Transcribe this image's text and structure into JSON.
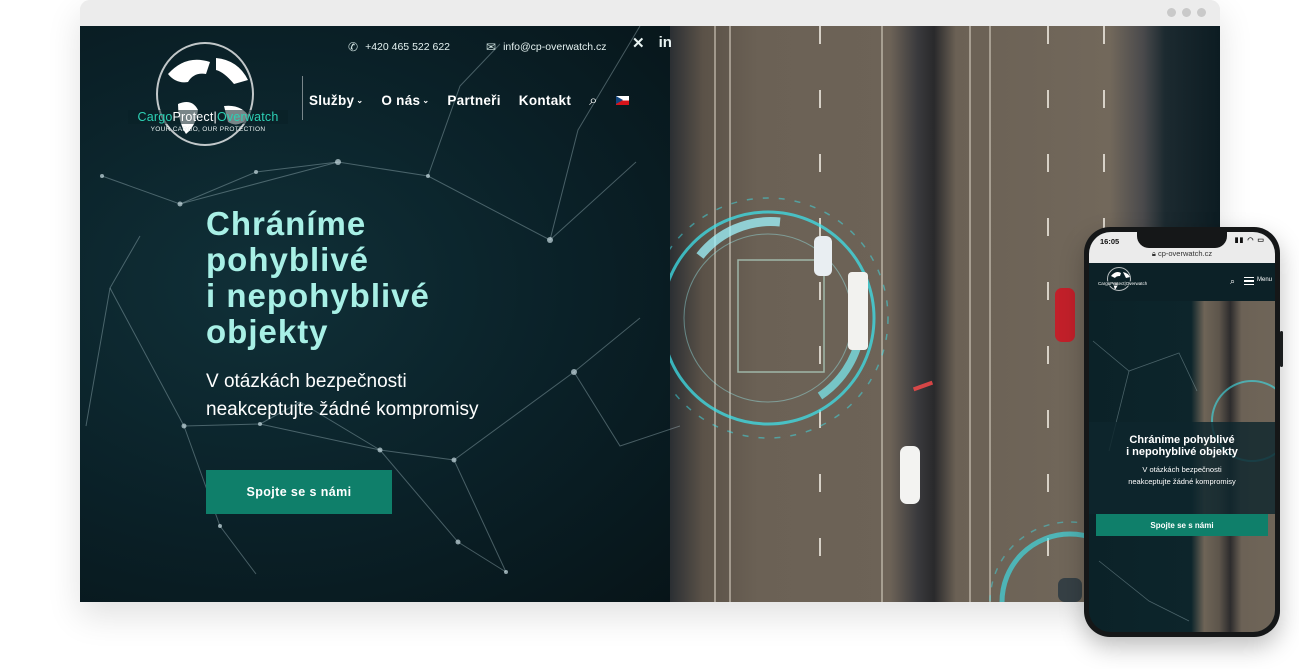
{
  "site": {
    "logo": {
      "brand_part1": "Cargo",
      "brand_part2": "Protect",
      "separator": "|",
      "brand_part3": "Overwatch",
      "tagline": "YOUR CARGO, OUR PROTECTION"
    },
    "topbar": {
      "phone": "+420 465 522 622",
      "email": "info@cp-overwatch.cz"
    },
    "social": {
      "xing": "✕",
      "linkedin": "in"
    },
    "nav": {
      "items": [
        {
          "label": "Služby",
          "has_dropdown": true
        },
        {
          "label": "O nás",
          "has_dropdown": true
        },
        {
          "label": "Partneři",
          "has_dropdown": false
        },
        {
          "label": "Kontakt",
          "has_dropdown": false
        }
      ],
      "search_icon": "search-icon",
      "language": "cz-flag"
    },
    "hero": {
      "title_lines": [
        "Chráníme",
        "pohyblivé",
        "i nepohyblivé",
        "objekty"
      ],
      "subtitle_lines": [
        "V otázkách bezpečnosti",
        "neakceptujte žádné kompromisy"
      ],
      "cta_label": "Spojte se s námi"
    }
  },
  "mobile": {
    "time": "16:05",
    "url": "cp-overwatch.cz",
    "menu_label": "Menu",
    "hero_title_lines": [
      "Chráníme pohyblivé",
      "i nepohyblivé objekty"
    ],
    "hero_subtitle_lines": [
      "V otázkách bezpečnosti",
      "neakceptujte žádné kompromisy"
    ],
    "cta_label": "Spojte se s námi"
  },
  "colors": {
    "accent": "#0f7f6a",
    "hero_title": "#a8f0e6",
    "logo_accent": "#2dd0b4",
    "dark_bg": "#0c2127",
    "scan_ring": "#3de0ea"
  }
}
